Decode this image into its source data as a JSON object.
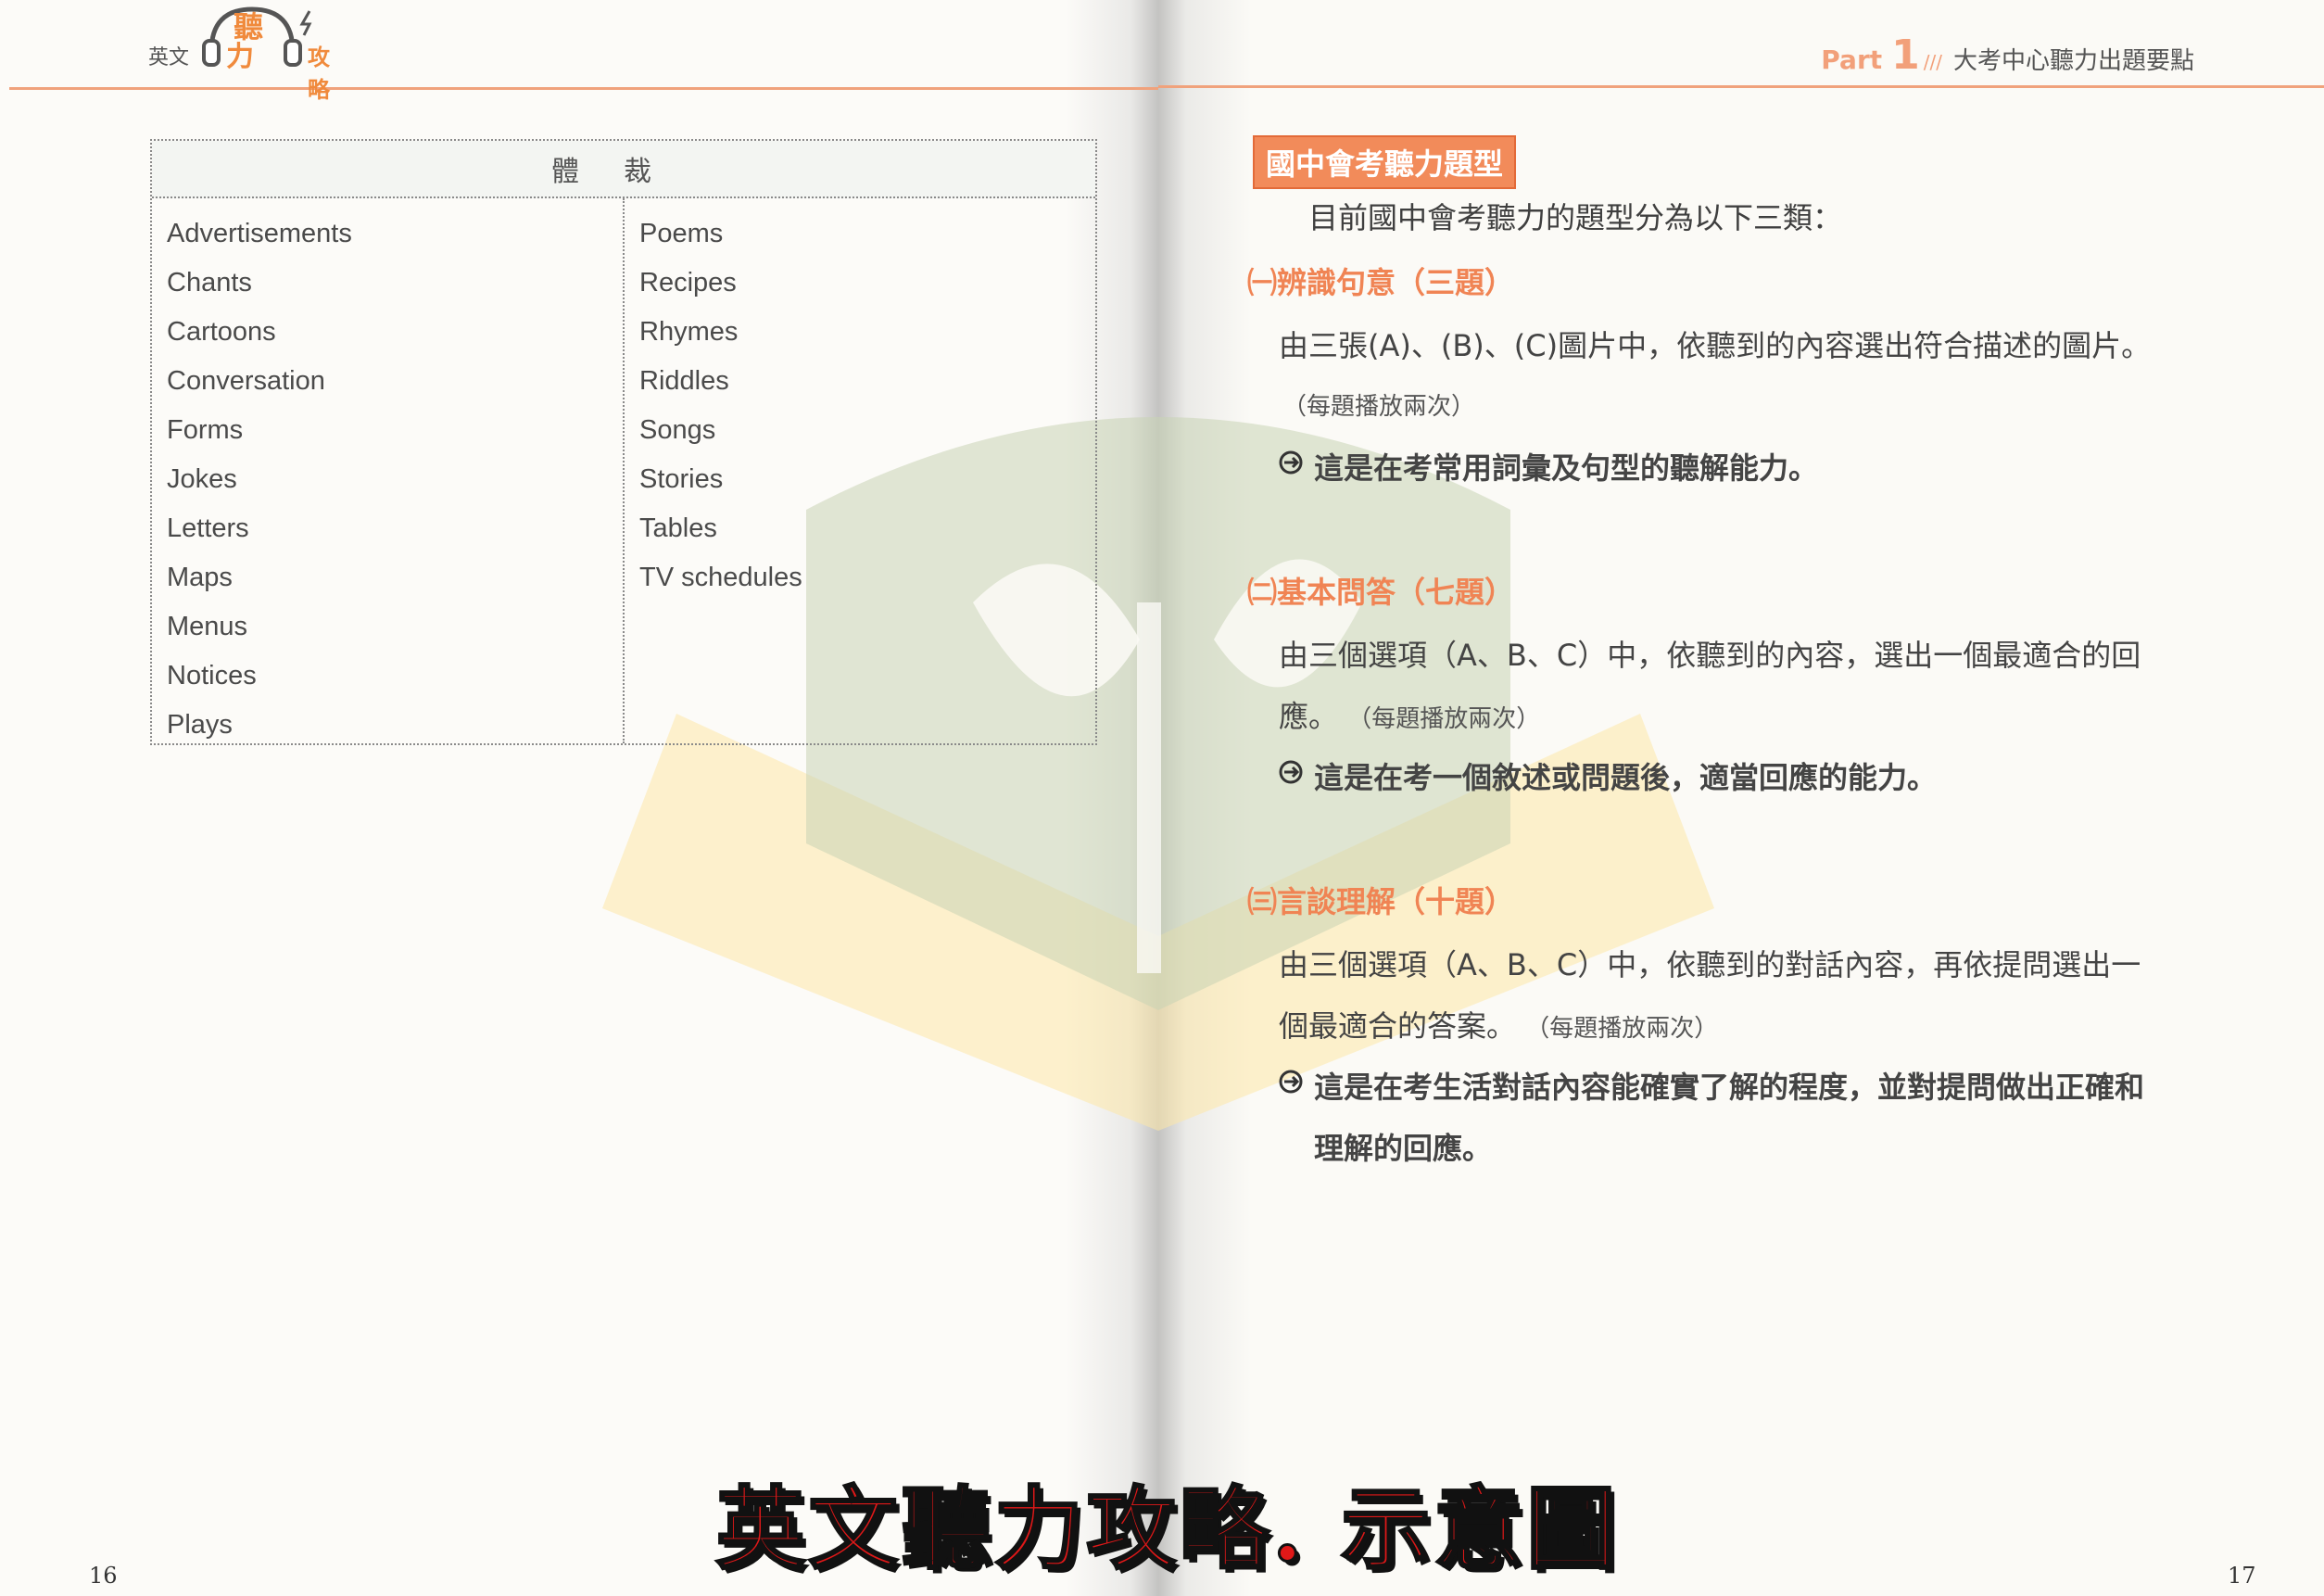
{
  "header_left": {
    "book_label": "英文",
    "logo_text_top": "聽",
    "logo_text_mid": "力",
    "logo_text_side": "攻略"
  },
  "header_right": {
    "part_word": "Part",
    "part_num": "1",
    "title": "大考中心聽力出題要點"
  },
  "genre_table": {
    "header": "體裁",
    "left_items": [
      "Advertisements",
      "Chants",
      "Cartoons",
      "Conversation",
      "Forms",
      "Jokes",
      "Letters",
      "Maps",
      "Menus",
      "Notices",
      "Plays"
    ],
    "right_items": [
      "Poems",
      "Recipes",
      "Rhymes",
      "Riddles",
      "Songs",
      "Stories",
      "Tables",
      "TV schedules"
    ]
  },
  "right_page": {
    "section_title": "國中會考聽力題型",
    "intro": "目前國中會考聽力的題型分為以下三類：",
    "sections": [
      {
        "heading": "㈠辨識句意（三題）",
        "lines": [
          "由三張(A)、(B)、(C)圖片中，依聽到的內容選出符合描述的圖片。"
        ],
        "note": "（每題播放兩次）",
        "bullet": "這是在考常用詞彙及句型的聽解能力。"
      },
      {
        "heading": "㈡基本問答（七題）",
        "lines": [
          "由三個選項（A、B、C）中，依聽到的內容，選出一個最適合的回",
          "應。"
        ],
        "note": "（每題播放兩次）",
        "bullet": "這是在考一個敘述或問題後，適當回應的能力。"
      },
      {
        "heading": "㈢言談理解（十題）",
        "lines": [
          "由三個選項（A、B、C）中，依聽到的對話內容，再依提問選出一",
          "個最適合的答案。"
        ],
        "note": "（每題播放兩次）",
        "bullet": "這是在考生活對話內容能確實了解的程度，並對提問做出正確和",
        "bullet_cont": "理解的回應。"
      }
    ]
  },
  "page_numbers": {
    "left": "16",
    "right": "17"
  },
  "caption": "英文聽力攻略. 示意圖",
  "colors": {
    "accent_orange": "#f08454",
    "header_line": "#f0a27c",
    "caption_red": "#e01818"
  }
}
